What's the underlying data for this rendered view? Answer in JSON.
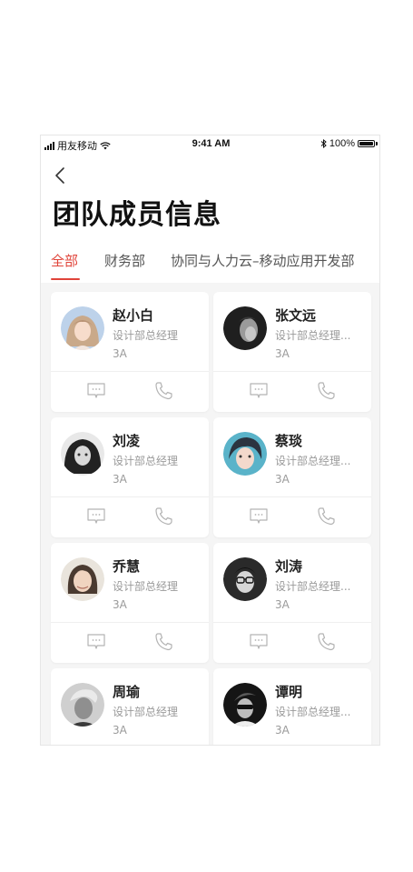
{
  "status_bar": {
    "carrier": "用友移动",
    "time": "9:41 AM",
    "battery": "100%"
  },
  "header": {
    "title": "团队成员信息"
  },
  "tabs": [
    {
      "label": "全部",
      "active": true
    },
    {
      "label": "财务部",
      "active": false
    },
    {
      "label": "协同与人力云–移动应用开发部",
      "active": false
    }
  ],
  "members": [
    {
      "name": "赵小白",
      "title": "设计部总经理",
      "level": "3A",
      "avatar": "woman-light-hair"
    },
    {
      "name": "张文远",
      "title": "设计部总经理...",
      "level": "3A",
      "avatar": "man-dark-portrait"
    },
    {
      "name": "刘凌",
      "title": "设计部总经理",
      "level": "3A",
      "avatar": "woman-dark-hair"
    },
    {
      "name": "蔡琰",
      "title": "设计部总经理...",
      "level": "3A",
      "avatar": "man-teal-portrait"
    },
    {
      "name": "乔慧",
      "title": "设计部总经理",
      "level": "3A",
      "avatar": "woman-brown-hair"
    },
    {
      "name": "刘涛",
      "title": "设计部总经理...",
      "level": "3A",
      "avatar": "man-glasses"
    },
    {
      "name": "周瑜",
      "title": "设计部总经理",
      "level": "3A",
      "avatar": "man-gray-portrait"
    },
    {
      "name": "谭明",
      "title": "设计部总经理...",
      "level": "3A",
      "avatar": "man-sunglasses"
    }
  ],
  "colors": {
    "accent": "#e0443a",
    "background": "#f5f5f5",
    "icon": "#b3b3b3"
  }
}
